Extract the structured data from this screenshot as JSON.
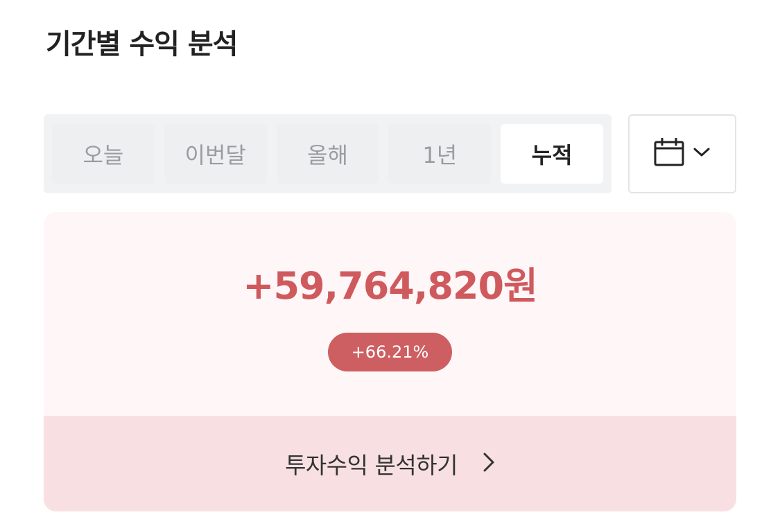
{
  "header": {
    "title": "기간별 수익 분석"
  },
  "period_tabs": {
    "items": [
      {
        "label": "오늘",
        "active": false
      },
      {
        "label": "이번달",
        "active": false
      },
      {
        "label": "올해",
        "active": false
      },
      {
        "label": "1년",
        "active": false
      },
      {
        "label": "누적",
        "active": true
      }
    ]
  },
  "date_picker": {
    "icon": "calendar-icon",
    "dropdown_icon": "chevron-down-icon"
  },
  "summary": {
    "amount": "+59,764,820원",
    "rate": "+66.21%",
    "link_label": "투자수익 분석하기",
    "link_icon": "chevron-right-icon"
  },
  "colors": {
    "profit_red": "#cf5a5e",
    "badge_bg": "#cd5f63",
    "card_bg": "#fff6f7",
    "footer_bg": "#f8e0e2",
    "tab_bg": "#f1f2f4"
  }
}
